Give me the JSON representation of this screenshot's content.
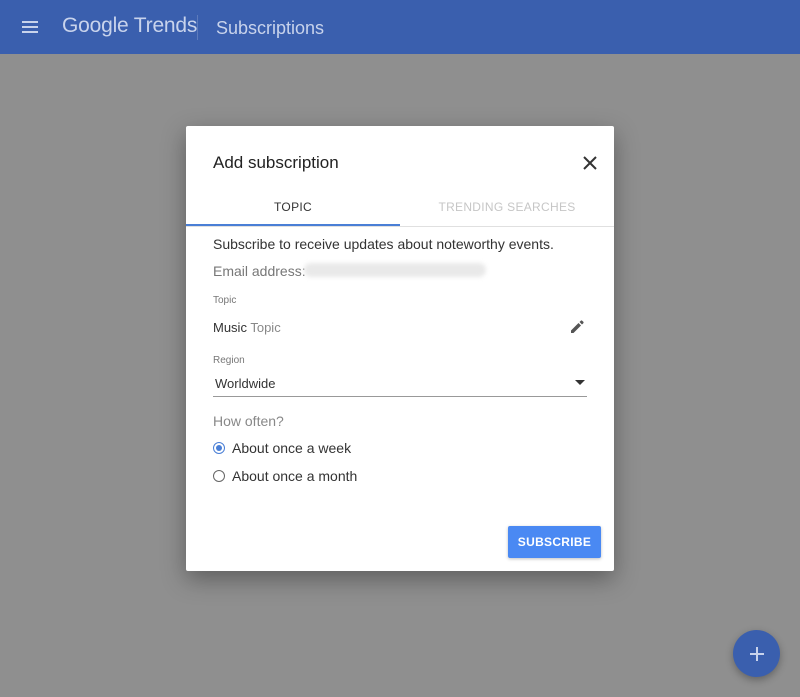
{
  "header": {
    "brand_google": "Google",
    "brand_trends": "Trends",
    "page_title": "Subscriptions"
  },
  "dialog": {
    "title": "Add subscription",
    "tabs": [
      {
        "label": "TOPIC",
        "active": true
      },
      {
        "label": "TRENDING SEARCHES",
        "active": false
      }
    ],
    "description": "Subscribe to receive updates about noteworthy events.",
    "email_label": "Email address:",
    "topic_label": "Topic",
    "topic_value": "Music",
    "topic_type": "Topic",
    "region_label": "Region",
    "region_value": "Worldwide",
    "frequency_label": "How often?",
    "frequency_options": [
      {
        "label": "About once a week",
        "checked": true
      },
      {
        "label": "About once a month",
        "checked": false
      }
    ],
    "subscribe_label": "SUBSCRIBE"
  },
  "icons": {
    "menu": "menu-icon",
    "close": "close-icon",
    "edit": "pencil-icon",
    "dropdown": "dropdown-arrow-icon",
    "add": "plus-icon"
  },
  "colors": {
    "header_bg": "#3a5fae",
    "accent": "#4a7fd6",
    "button": "#4a89f3",
    "overlay": "#8f8f8f"
  }
}
